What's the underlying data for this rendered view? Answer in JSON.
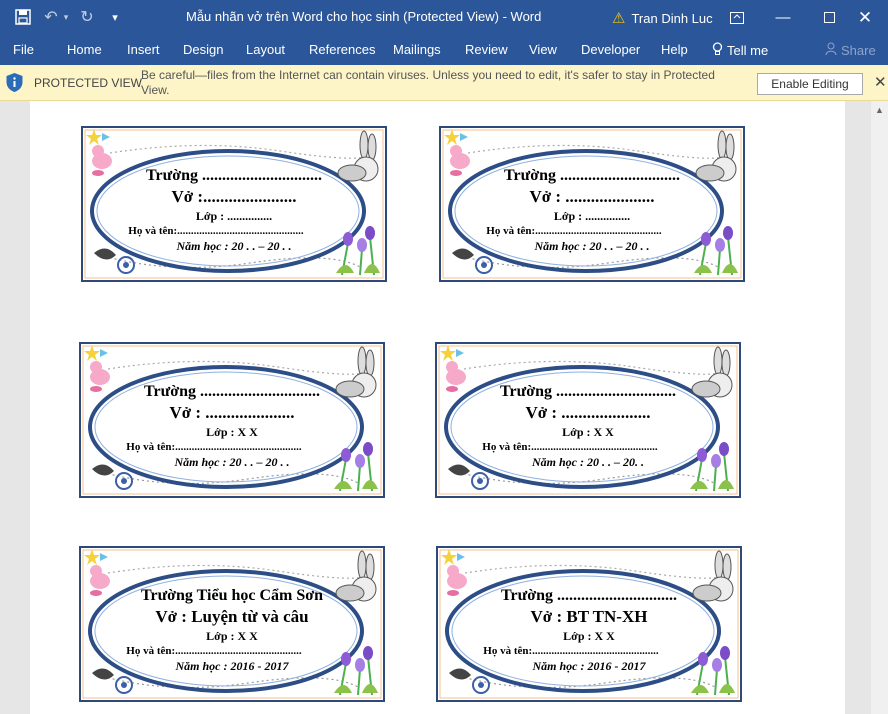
{
  "titlebar": {
    "title": "Mẫu nhãn vở trên Word cho học sinh (Protected View)  -  Word",
    "user": "Tran Dinh Luc"
  },
  "ribbon": {
    "tabs": [
      "File",
      "Home",
      "Insert",
      "Design",
      "Layout",
      "References",
      "Mailings",
      "Review",
      "View",
      "Developer",
      "Help",
      "Tell me",
      "Share"
    ]
  },
  "protected_view": {
    "title": "PROTECTED VIEW",
    "message": "Be careful—files from the Internet can contain viruses. Unless you need to edit, it's safer to stay in Protected View.",
    "button": "Enable Editing"
  },
  "labels": [
    {
      "school": "Trường ..............................",
      "subject": "Vở  :......................",
      "class": "Lớp : ...............",
      "name": "Họ và tên:..............................................",
      "year": "Năm học : 20 . . – 20 . ."
    },
    {
      "school": "Trường ..............................",
      "subject": "Vở  : .....................",
      "class": "Lớp : ...............",
      "name": "Họ và tên:..............................................",
      "year": "Năm học : 20 . . – 20 . ."
    },
    {
      "school": "Trường ..............................",
      "subject": "Vở  : .....................",
      "class": "Lớp : X X",
      "name": "Họ và tên:..............................................",
      "year": "Năm học : 20 . . – 20 . ."
    },
    {
      "school": "Trường ..............................",
      "subject": "Vở  : .....................",
      "class": "Lớp : X X",
      "name": "Họ và tên:..............................................",
      "year": "Năm học : 20 . . – 20. ."
    },
    {
      "school": "Trường Tiểu học Cẩm Sơn",
      "subject": "Vở  : Luyện từ và câu",
      "class": "Lớp : X X",
      "name": "Họ và tên:..............................................",
      "year": "Năm học : 2016 - 2017"
    },
    {
      "school": "Trường ..............................",
      "subject": "Vở  : BT TN-XH",
      "class": "Lớp : X X",
      "name": "Họ và tên:..............................................",
      "year": "Năm học : 2016 - 2017"
    }
  ],
  "colors": {
    "word_blue": "#2b579a",
    "banner": "#fdf5c8",
    "frame_border": "#2e4a7a",
    "ellipse": "#2c4d86"
  }
}
